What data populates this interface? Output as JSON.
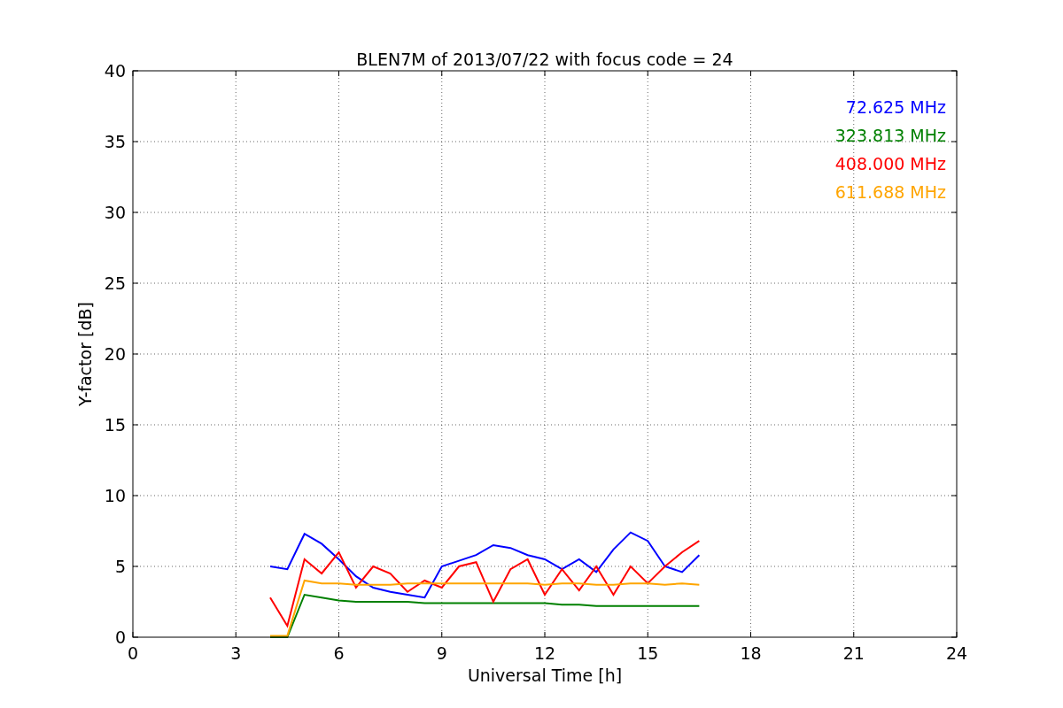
{
  "chart_data": {
    "type": "line",
    "title": "BLEN7M of 2013/07/22 with focus code = 24",
    "xlabel": "Universal Time [h]",
    "ylabel": "Y-factor [dB]",
    "x": [
      4,
      4.5,
      5,
      5.5,
      6,
      6.5,
      7,
      7.5,
      8,
      8.5,
      9,
      9.5,
      10,
      10.5,
      11,
      11.5,
      12,
      12.5,
      13,
      13.5,
      14,
      14.5,
      15,
      15.5,
      16,
      16.5
    ],
    "series": [
      {
        "name": "72.625 MHz",
        "color": "#0000ff",
        "values": [
          5.0,
          4.8,
          7.3,
          6.6,
          5.5,
          4.3,
          3.5,
          3.2,
          3.0,
          2.8,
          5.0,
          5.4,
          5.8,
          6.5,
          6.3,
          5.8,
          5.5,
          4.8,
          5.5,
          4.6,
          6.2,
          7.4,
          6.8,
          5.0,
          4.6,
          5.8
        ]
      },
      {
        "name": "323.813 MHz",
        "color": "#008000",
        "values": [
          0,
          0,
          3.0,
          2.8,
          2.6,
          2.5,
          2.5,
          2.5,
          2.5,
          2.4,
          2.4,
          2.4,
          2.4,
          2.4,
          2.4,
          2.4,
          2.4,
          2.3,
          2.3,
          2.2,
          2.2,
          2.2,
          2.2,
          2.2,
          2.2,
          2.2
        ]
      },
      {
        "name": "408.000 MHz",
        "color": "#ff0000",
        "values": [
          2.8,
          0.8,
          5.5,
          4.5,
          6.0,
          3.5,
          5.0,
          4.5,
          3.2,
          4.0,
          3.5,
          5.0,
          5.3,
          2.5,
          4.8,
          5.5,
          3.0,
          4.8,
          3.3,
          5.0,
          3.0,
          5.0,
          3.8,
          5.0,
          6.0,
          6.8
        ]
      },
      {
        "name": "611.688 MHz",
        "color": "#ffa500",
        "values": [
          0.1,
          0.1,
          4.0,
          3.8,
          3.8,
          3.7,
          3.7,
          3.7,
          3.8,
          3.8,
          3.8,
          3.8,
          3.8,
          3.8,
          3.8,
          3.8,
          3.7,
          3.8,
          3.8,
          3.7,
          3.7,
          3.8,
          3.8,
          3.7,
          3.8,
          3.7
        ]
      }
    ],
    "grid": true,
    "xlim": [
      0,
      24
    ],
    "ylim": [
      0,
      40
    ],
    "xticks": [
      0,
      3,
      6,
      9,
      12,
      15,
      18,
      21,
      24
    ],
    "yticks": [
      0,
      5,
      10,
      15,
      20,
      25,
      30,
      35,
      40
    ]
  }
}
